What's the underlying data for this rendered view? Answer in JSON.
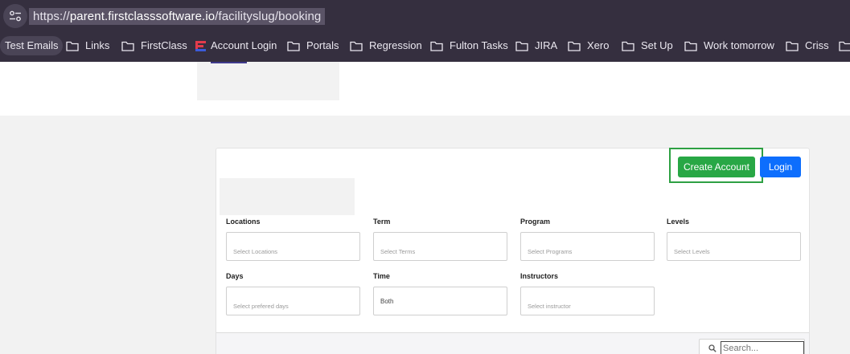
{
  "browser": {
    "url_scheme": "https://",
    "url_host": "parent.firstclasssoftware.io",
    "url_path": "/facilityslug/booking"
  },
  "bookmarks": [
    {
      "label": "Test Emails",
      "icon": "none"
    },
    {
      "label": "Links",
      "icon": "folder-icon"
    },
    {
      "label": "FirstClass",
      "icon": "folder-icon"
    },
    {
      "label": "Account Login",
      "icon": "firstclass-logo-icon"
    },
    {
      "label": "Portals",
      "icon": "folder-icon"
    },
    {
      "label": "Regression",
      "icon": "folder-icon"
    },
    {
      "label": "Fulton Tasks",
      "icon": "folder-icon"
    },
    {
      "label": "JIRA",
      "icon": "folder-icon"
    },
    {
      "label": "Xero",
      "icon": "folder-icon"
    },
    {
      "label": "Set Up",
      "icon": "folder-icon"
    },
    {
      "label": "Work tomorrow",
      "icon": "folder-icon"
    },
    {
      "label": "Criss",
      "icon": "folder-icon"
    }
  ],
  "actions": {
    "create_account": "Create Account",
    "login": "Login"
  },
  "filters": {
    "locations": {
      "label": "Locations",
      "placeholder": "Select Locations"
    },
    "term": {
      "label": "Term",
      "placeholder": "Select Terms"
    },
    "program": {
      "label": "Program",
      "placeholder": "Select Programs"
    },
    "levels": {
      "label": "Levels",
      "placeholder": "Select Levels"
    },
    "days": {
      "label": "Days",
      "placeholder": "Select prefered days"
    },
    "time": {
      "label": "Time",
      "value": "Both"
    },
    "instructors": {
      "label": "Instructors",
      "placeholder": "Select instructor"
    }
  },
  "search": {
    "placeholder": "Search..."
  },
  "colors": {
    "browser_chrome": "#352f3f",
    "create_button": "#28a745",
    "login_button": "#0d6efd",
    "highlight_box": "#2ea043"
  }
}
